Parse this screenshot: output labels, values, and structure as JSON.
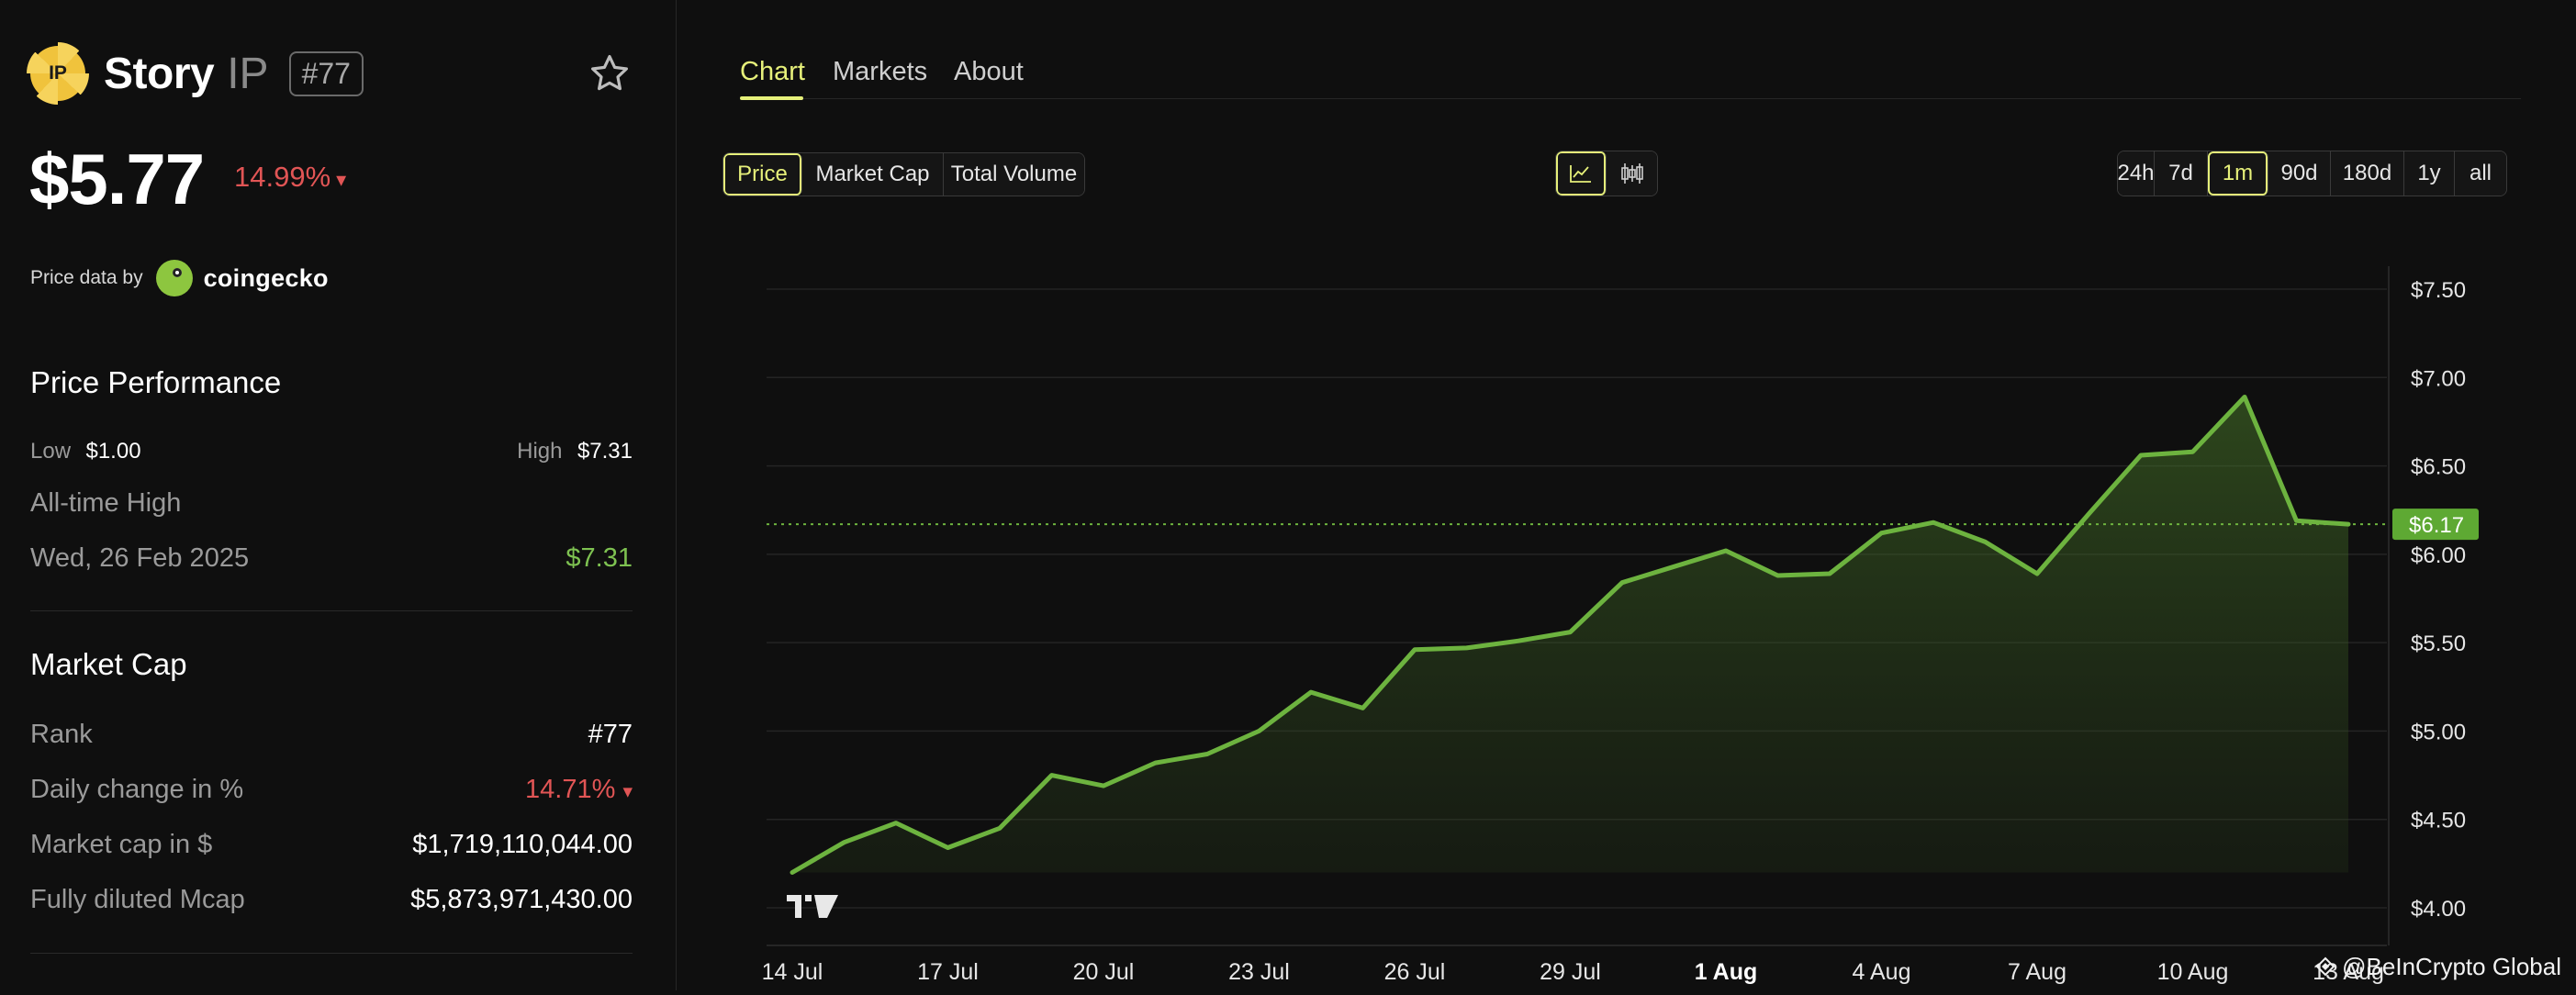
{
  "coin": {
    "logo_text": "IP",
    "name": "Story",
    "symbol": "IP",
    "rank_badge": "#77",
    "price": "$5.77",
    "change": "14.99%",
    "change_arrow": "▾"
  },
  "source": {
    "label": "Price data by",
    "provider": "coingecko"
  },
  "performance": {
    "title": "Price Performance",
    "low_label": "Low",
    "low_value": "$1.00",
    "high_label": "High",
    "high_value": "$7.31",
    "ath_label": "All-time High",
    "ath_date": "Wed, 26 Feb 2025",
    "ath_value": "$7.31"
  },
  "market_cap": {
    "title": "Market Cap",
    "rows": [
      {
        "label": "Rank",
        "value": "#77"
      },
      {
        "label": "Daily change in %",
        "value": "14.71%",
        "arrow": "▾"
      },
      {
        "label": "Market cap in $",
        "value": "$1,719,110,044.00"
      },
      {
        "label": "Fully diluted Mcap",
        "value": "$5,873,971,430.00"
      }
    ]
  },
  "tabs": [
    {
      "label": "Chart",
      "active": true
    },
    {
      "label": "Markets",
      "active": false
    },
    {
      "label": "About",
      "active": false
    }
  ],
  "metric_buttons": [
    "Price",
    "Market Cap",
    "Total Volume"
  ],
  "metric_active": "Price",
  "chart_type_buttons": [
    "line-chart-icon",
    "candlestick-icon"
  ],
  "range_buttons": [
    "24h",
    "7d",
    "1m",
    "90d",
    "180d",
    "1y",
    "all"
  ],
  "range_active": "1m",
  "colors": {
    "accent": "#e6f07a",
    "line": "#6db33f",
    "negative": "#e15555",
    "positive": "#7ec251"
  },
  "watermark": "@BeInCrypto Global",
  "chart_data": {
    "type": "area",
    "x": [
      "14 Jul",
      "15 Jul",
      "16 Jul",
      "17 Jul",
      "18 Jul",
      "19 Jul",
      "20 Jul",
      "21 Jul",
      "22 Jul",
      "23 Jul",
      "24 Jul",
      "25 Jul",
      "26 Jul",
      "27 Jul",
      "28 Jul",
      "29 Jul",
      "30 Jul",
      "31 Jul",
      "1 Aug",
      "2 Aug",
      "3 Aug",
      "4 Aug",
      "5 Aug",
      "6 Aug",
      "7 Aug",
      "8 Aug",
      "9 Aug",
      "10 Aug",
      "11 Aug",
      "12 Aug",
      "13 Aug"
    ],
    "series": [
      {
        "values": [
          4.2,
          4.37,
          4.48,
          4.34,
          4.45,
          4.75,
          4.69,
          4.82,
          4.87,
          5.0,
          5.22,
          5.13,
          5.46,
          5.47,
          5.51,
          5.56,
          5.84,
          5.93,
          6.02,
          5.88,
          5.89,
          6.12,
          6.18,
          6.07,
          5.89,
          6.23,
          6.56,
          6.58,
          6.89,
          6.19,
          6.17
        ]
      }
    ],
    "x_tick_labels": [
      "14 Jul",
      "17 Jul",
      "20 Jul",
      "23 Jul",
      "26 Jul",
      "29 Jul",
      "1 Aug",
      "4 Aug",
      "7 Aug",
      "10 Aug",
      "13 Aug"
    ],
    "y_tick_labels": [
      "$7.50",
      "$7.00",
      "$6.50",
      "$6.00",
      "$5.50",
      "$5.00",
      "$4.50",
      "$4.00"
    ],
    "ylim": [
      4.0,
      7.5
    ],
    "current_price": 6.17,
    "current_label": "$6.17",
    "grid": true
  }
}
